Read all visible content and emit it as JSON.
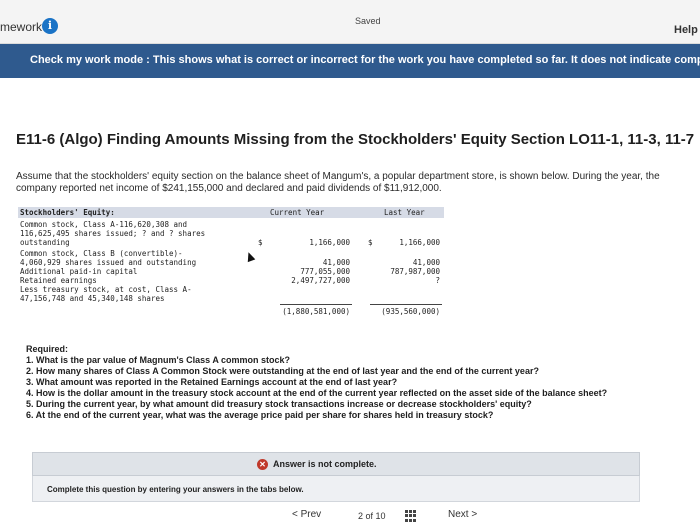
{
  "topbar": {
    "brand": "mework",
    "info_icon": "info-icon",
    "saved": "Saved",
    "help": "Help"
  },
  "banner": "Check my work mode : This shows what is correct or incorrect for the work you have completed so far. It does not indicate compl",
  "title": "E11-6 (Algo) Finding Amounts Missing from the Stockholders' Equity Section LO11-1, 11-3, 11-7",
  "intro": "Assume that the stockholders' equity section on the balance sheet of Mangum's, a popular department store, is shown below. During the year, the company reported net income of $241,155,000 and declared and paid dividends of $11,912,000.",
  "ledger": {
    "header": "Stockholders' Equity:",
    "current_year": "Current Year",
    "last_year": "Last Year",
    "rows": [
      {
        "label": "Common stock, Class A-116,620,308 and"
      },
      {
        "label": "116,625,495 shares issued; ? and ? shares"
      },
      {
        "label": "outstanding",
        "cur_dollar": "$",
        "cur": "1,166,000",
        "last_dollar": "$",
        "last": "1,166,000"
      },
      {
        "label": "Common stock, Class B (convertible)-"
      },
      {
        "label": "4,060,929 shares issued and outstanding",
        "cur": "41,000",
        "last": "41,000"
      },
      {
        "label": "Additional paid-in capital",
        "cur": "777,055,000",
        "last": "787,987,000"
      },
      {
        "label": "Retained earnings",
        "cur": "2,497,727,000",
        "last": "?"
      },
      {
        "label": "Less treasury stock, at cost, Class A-"
      },
      {
        "label": "47,156,748 and 45,340,148 shares",
        "cur": "(1,880,581,000)",
        "last": "(935,560,000)"
      }
    ]
  },
  "required": {
    "title": "Required:",
    "items": [
      "1. What is the par value of Magnum's Class A common stock?",
      "2. How many shares of Class A Common Stock were outstanding at the end of last year and the end of the current year?",
      "3. What amount was reported in the Retained Earnings account at the end of last year?",
      "4. How is the dollar amount in the treasury stock account at the end of the current year reflected on the asset side of the balance sheet?",
      "5. During the current year, by what amount did treasury stock transactions increase or decrease stockholders' equity?",
      "6. At the end of the current year, what was the average price paid per share for shares held in treasury stock?"
    ]
  },
  "status": {
    "icon": "error-x-icon",
    "text": "Answer is not complete."
  },
  "complete_msg": "Complete this question by entering your answers in the tabs below.",
  "nav": {
    "prev": "< Prev",
    "page": "2 of 10",
    "next": "Next >"
  },
  "colors": {
    "banner": "#2f5a8e",
    "table_header": "#d6dbe6",
    "status_bar": "#dfe3e8",
    "error": "#c0392b",
    "info": "#1a73c6"
  }
}
